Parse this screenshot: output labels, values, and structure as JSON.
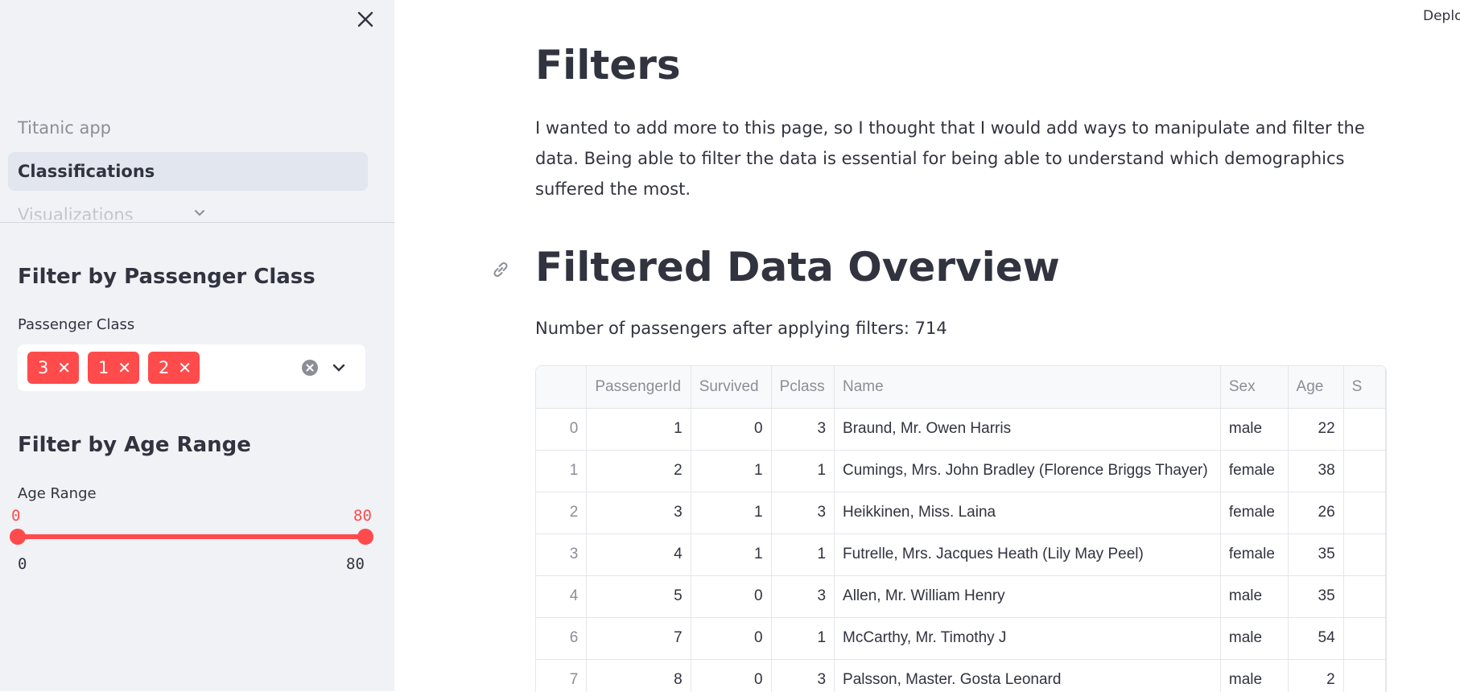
{
  "sidebar": {
    "nav": [
      {
        "label": "Titanic app"
      },
      {
        "label": "Classifications"
      },
      {
        "label": "Visualizations"
      }
    ],
    "class_filter": {
      "heading": "Filter by Passenger Class",
      "label": "Passenger Class",
      "selected": [
        "3",
        "1",
        "2"
      ]
    },
    "age_filter": {
      "heading": "Filter by Age Range",
      "label": "Age Range",
      "value_low": "0",
      "value_high": "80",
      "min": "0",
      "max": "80"
    }
  },
  "header": {
    "deploy_label": "Deploy"
  },
  "main": {
    "title": "Filters",
    "intro": "I wanted to add more to this page, so I thought that I would add ways to manipulate and filter the data. Being able to filter the data is essential for being able to understand which demographics suffered the most.",
    "section_title": "Filtered Data Overview",
    "count_text": "Number of passengers after applying filters: 714"
  },
  "table": {
    "columns": [
      "",
      "PassengerId",
      "Survived",
      "Pclass",
      "Name",
      "Sex",
      "Age",
      "S"
    ],
    "rows": [
      [
        "0",
        "1",
        "0",
        "3",
        "Braund, Mr. Owen Harris",
        "male",
        "22"
      ],
      [
        "1",
        "2",
        "1",
        "1",
        "Cumings, Mrs. John Bradley (Florence Briggs Thayer)",
        "female",
        "38"
      ],
      [
        "2",
        "3",
        "1",
        "3",
        "Heikkinen, Miss. Laina",
        "female",
        "26"
      ],
      [
        "3",
        "4",
        "1",
        "1",
        "Futrelle, Mrs. Jacques Heath (Lily May Peel)",
        "female",
        "35"
      ],
      [
        "4",
        "5",
        "0",
        "3",
        "Allen, Mr. William Henry",
        "male",
        "35"
      ],
      [
        "6",
        "7",
        "0",
        "1",
        "McCarthy, Mr. Timothy J",
        "male",
        "54"
      ],
      [
        "7",
        "8",
        "0",
        "3",
        "Palsson, Master. Gosta Leonard",
        "male",
        "2"
      ]
    ]
  },
  "colors": {
    "accent": "#ff4b4b",
    "sidebar_bg": "#f0f2f6",
    "text": "#31333f"
  }
}
